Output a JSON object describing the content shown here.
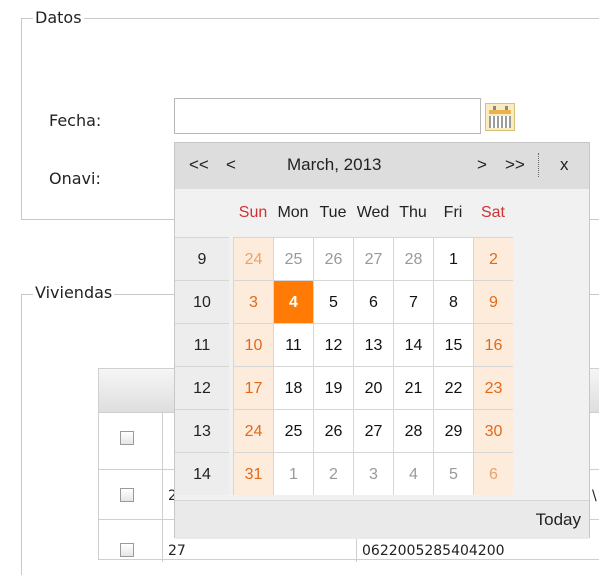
{
  "datos": {
    "legend": "Datos",
    "fecha_label": "Fecha:",
    "fecha_value": "",
    "onavi_label": "Onavi:"
  },
  "viviendas": {
    "legend": "Viviendas"
  },
  "table_fragments": {
    "row1_left": "2",
    "row1_right": "\\",
    "row2_left": "27",
    "row2_right": "0622005285404200"
  },
  "calendar": {
    "nav": {
      "prev_year": "<<",
      "prev_month": "<",
      "month_title": "March, 2013",
      "next_month": ">",
      "next_year": ">>",
      "close": "x"
    },
    "day_names": [
      "Sun",
      "Mon",
      "Tue",
      "Wed",
      "Thu",
      "Fri",
      "Sat"
    ],
    "weeks": [
      {
        "wk": "9",
        "days": [
          "24",
          "25",
          "26",
          "27",
          "28",
          "1",
          "2"
        ]
      },
      {
        "wk": "10",
        "days": [
          "3",
          "4",
          "5",
          "6",
          "7",
          "8",
          "9"
        ]
      },
      {
        "wk": "11",
        "days": [
          "10",
          "11",
          "12",
          "13",
          "14",
          "15",
          "16"
        ]
      },
      {
        "wk": "12",
        "days": [
          "17",
          "18",
          "19",
          "20",
          "21",
          "22",
          "23"
        ]
      },
      {
        "wk": "13",
        "days": [
          "24",
          "25",
          "26",
          "27",
          "28",
          "29",
          "30"
        ]
      },
      {
        "wk": "14",
        "days": [
          "31",
          "1",
          "2",
          "3",
          "4",
          "5",
          "6"
        ]
      }
    ],
    "selected": "4",
    "today_label": "Today"
  }
}
